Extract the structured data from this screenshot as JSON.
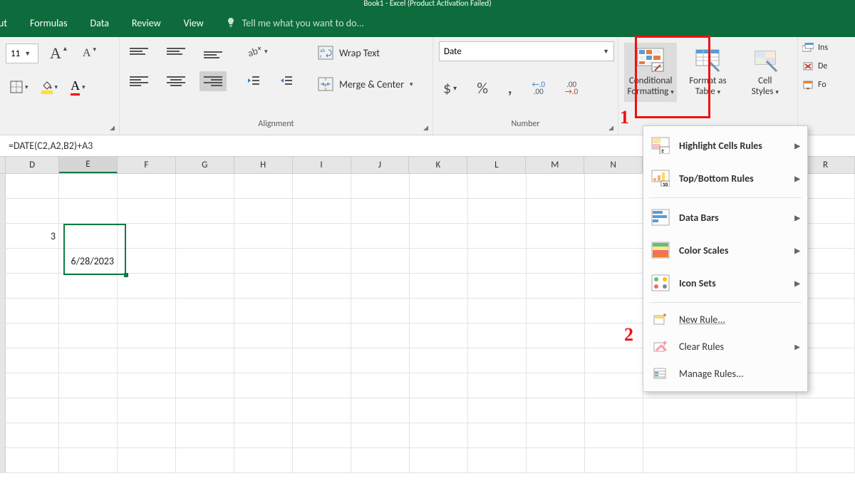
{
  "title": "Book1 - Excel (Product Activation Failed)",
  "tabs": {
    "t0": "ut",
    "t1": "Formulas",
    "t2": "Data",
    "t3": "Review",
    "t4": "View"
  },
  "tell_me": "Tell me what you want to do...",
  "font": {
    "size": "11",
    "increase": "A",
    "decrease": "A"
  },
  "alignment": {
    "wrap": "Wrap Text",
    "merge": "Merge & Center",
    "group": "Alignment"
  },
  "number": {
    "format": "Date",
    "group": "Number"
  },
  "styles": {
    "cond": "Conditional Formatting",
    "cond_line1": "Conditional",
    "cond_line2": "Formatting",
    "table": "Format as Table",
    "table_line1": "Format as",
    "table_line2": "Table",
    "cell": "Cell Styles",
    "cell_line1": "Cell",
    "cell_line2": "Styles"
  },
  "right": {
    "insert": "Ins",
    "delete": "De",
    "format": "Fo"
  },
  "cf_menu": {
    "hcr": "Highlight Cells Rules",
    "tbr": "Top/Bottom Rules",
    "db": "Data Bars",
    "cs": "Color Scales",
    "is": "Icon Sets",
    "new": "New Rule...",
    "clear": "Clear Rules",
    "manage": "Manage Rules..."
  },
  "formula": "=DATE(C2,A2,B2)+A3",
  "annotations": {
    "n1": "1",
    "n2": "2"
  },
  "columns": [
    "D",
    "E",
    "F",
    "G",
    "H",
    "I",
    "J",
    "K",
    "L",
    "M",
    "N",
    "R"
  ],
  "selected_column": "E",
  "cell_value": "6/28/2023"
}
